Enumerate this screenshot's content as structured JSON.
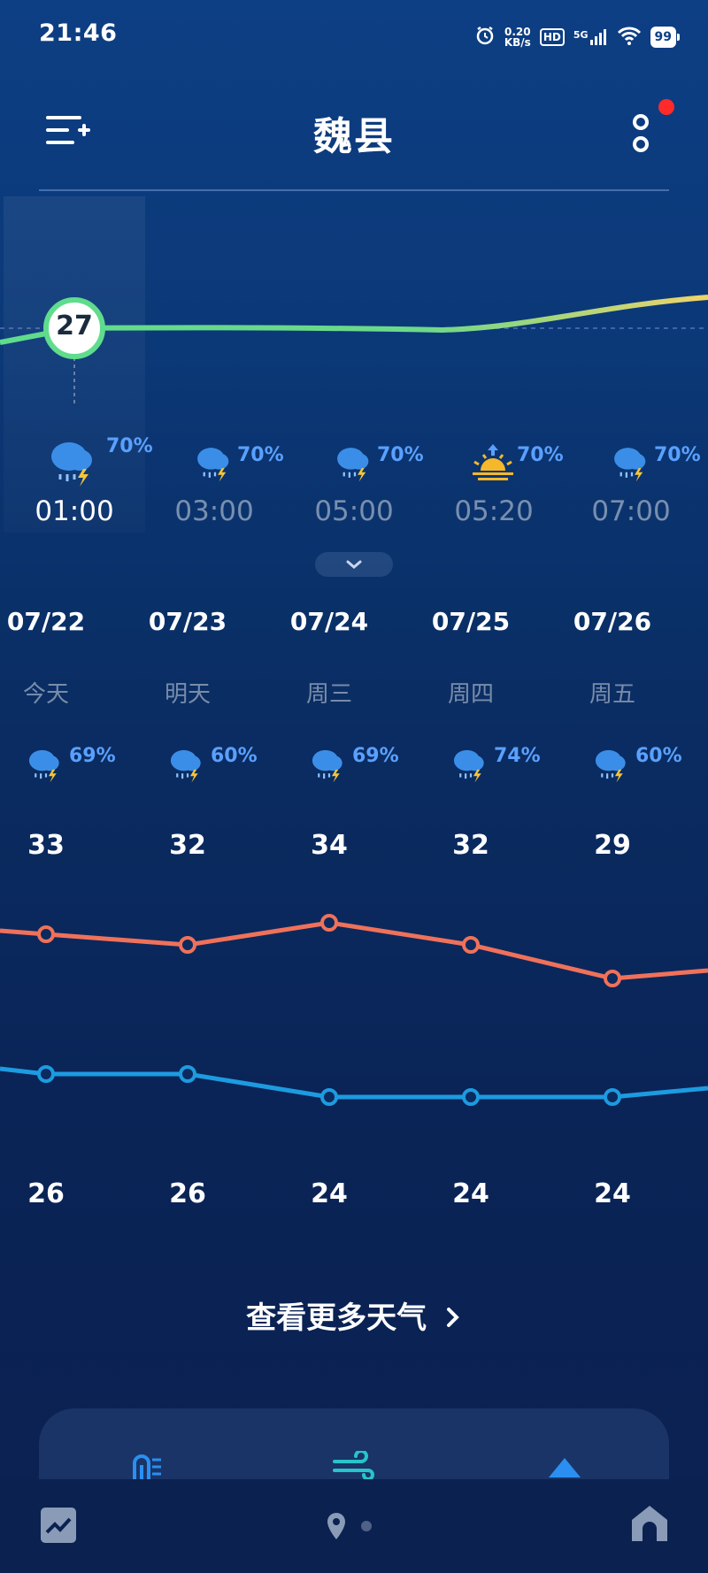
{
  "status_bar": {
    "time": "21:46",
    "net_speed_value": "0.20",
    "net_speed_unit": "KB/s",
    "hd": "HD",
    "signal": "5G",
    "battery": "99"
  },
  "header": {
    "city": "魏县"
  },
  "hourly": {
    "current_temp": "27",
    "items": [
      {
        "time": "01:00",
        "precip": "70%",
        "icon": "thunderstorm-icon",
        "active": true
      },
      {
        "time": "03:00",
        "precip": "70%",
        "icon": "thunderstorm-icon",
        "active": false
      },
      {
        "time": "05:00",
        "precip": "70%",
        "icon": "thunderstorm-icon",
        "active": false
      },
      {
        "time": "05:20",
        "precip": "70%",
        "icon": "sunrise-icon",
        "active": false
      },
      {
        "time": "07:00",
        "precip": "70%",
        "icon": "thunderstorm-icon",
        "active": false
      }
    ]
  },
  "daily": {
    "items": [
      {
        "date": "07/22",
        "week": "今天",
        "precip": "69%",
        "high": "33",
        "low": "26"
      },
      {
        "date": "07/23",
        "week": "明天",
        "precip": "60%",
        "high": "32",
        "low": "26"
      },
      {
        "date": "07/24",
        "week": "周三",
        "precip": "69%",
        "high": "34",
        "low": "24"
      },
      {
        "date": "07/25",
        "week": "周四",
        "precip": "74%",
        "high": "32",
        "low": "24"
      },
      {
        "date": "07/26",
        "week": "周五",
        "precip": "60%",
        "high": "29",
        "low": "24"
      }
    ]
  },
  "more_weather_label": "查看更多天气",
  "colors": {
    "accent_blue": "#5aa0ff",
    "high_line": "#f0715a",
    "low_line": "#1d9be0",
    "temp_line": "#5fdc8c"
  }
}
